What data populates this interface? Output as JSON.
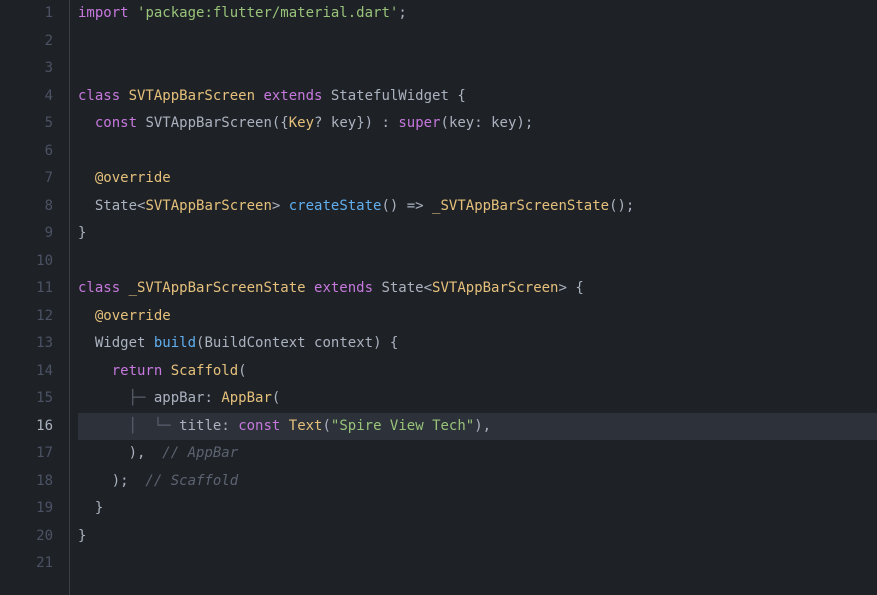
{
  "lines": {
    "n1": "1",
    "n2": "2",
    "n3": "3",
    "n4": "4",
    "n5": "5",
    "n6": "6",
    "n7": "7",
    "n8": "8",
    "n9": "9",
    "n10": "10",
    "n11": "11",
    "n12": "12",
    "n13": "13",
    "n14": "14",
    "n15": "15",
    "n16": "16",
    "n17": "17",
    "n18": "18",
    "n19": "19",
    "n20": "20",
    "n21": "21"
  },
  "code": {
    "l1": {
      "import": "import ",
      "pkg": "'package:flutter/material.dart'",
      "semi": ";"
    },
    "l4": {
      "class": "class ",
      "name": "SVTAppBarScreen ",
      "extends": "extends ",
      "base": "StatefulWidget ",
      "brace": "{"
    },
    "l5": {
      "indent": "  ",
      "const": "const ",
      "ctor": "SVTAppBarScreen",
      "open": "({",
      "keytype": "Key",
      "q": "? ",
      "keyparam": "key",
      "close": "}) : ",
      "super": "super",
      "p1": "(",
      "kn": "key",
      "colon": ": ",
      "kv": "key",
      "end": ");"
    },
    "l7": {
      "indent": "  ",
      "ann": "@override"
    },
    "l8": {
      "indent": "  ",
      "state": "State",
      "lt": "<",
      "gen": "SVTAppBarScreen",
      "gt": "> ",
      "fn": "createState",
      "par": "() => ",
      "priv": "_SVTAppBarScreenState",
      "end": "();"
    },
    "l9": {
      "brace": "}"
    },
    "l11": {
      "class": "class ",
      "name": "_SVTAppBarScreenState ",
      "extends": "extends ",
      "base": "State",
      "lt": "<",
      "gen": "SVTAppBarScreen",
      "gt": "> ",
      "brace": "{"
    },
    "l12": {
      "indent": "  ",
      "ann": "@override"
    },
    "l13": {
      "indent": "  ",
      "widget": "Widget ",
      "fn": "build",
      "open": "(",
      "ctx": "BuildContext ",
      "param": "context",
      "close": ") {"
    },
    "l14": {
      "indent": "    ",
      "return": "return ",
      "scaffold": "Scaffold",
      "open": "("
    },
    "l15": {
      "indent": "      ",
      "tree": "├─ ",
      "prop": "appBar",
      "colon": ": ",
      "appbar": "AppBar",
      "open": "("
    },
    "l16": {
      "indent": "      ",
      "tree1": "│  ",
      "tree2": "└─ ",
      "prop": "title",
      "colon": ": ",
      "const": "const ",
      "text": "Text",
      "open": "(",
      "str": "\"Spire View Tech\"",
      "close": "),"
    },
    "l17": {
      "indent": "      ",
      "close": "),",
      "comment": "  // AppBar"
    },
    "l18": {
      "indent": "    ",
      "close": ");",
      "comment": "  // Scaffold"
    },
    "l19": {
      "indent": "  ",
      "brace": "}"
    },
    "l20": {
      "brace": "}"
    }
  },
  "icons": {
    "override": "◉",
    "up": "↑"
  },
  "current_line": 16
}
